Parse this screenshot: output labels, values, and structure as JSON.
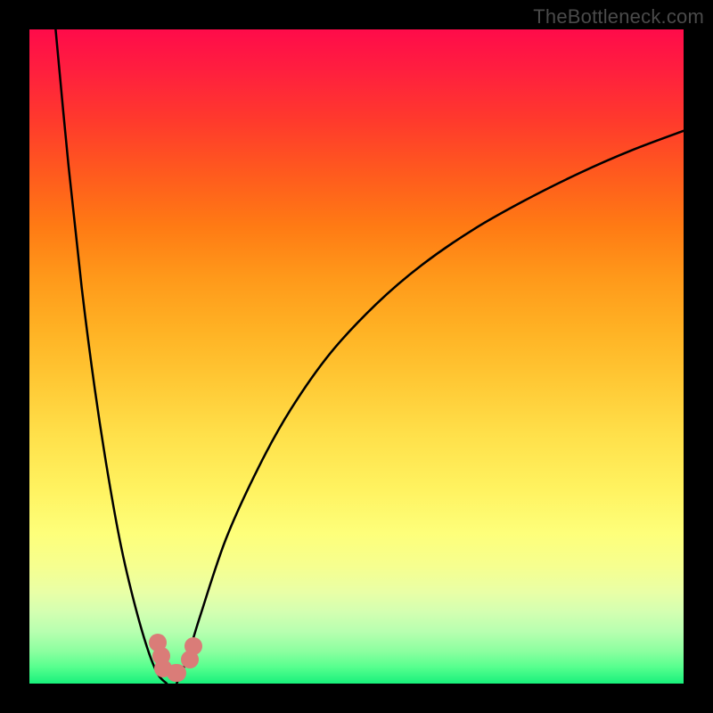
{
  "watermark": "TheBottleneck.com",
  "chart_data": {
    "type": "line",
    "title": "",
    "xlabel": "",
    "ylabel": "",
    "xlim": [
      0,
      100
    ],
    "ylim": [
      0,
      100
    ],
    "grid": false,
    "legend": false,
    "series": [
      {
        "name": "left-branch",
        "x": [
          4.0,
          6.0,
          8.0,
          10.0,
          12.0,
          14.0,
          16.0,
          18.0,
          19.6,
          21.0
        ],
        "values": [
          100.0,
          79.0,
          60.5,
          45.0,
          32.0,
          21.0,
          12.5,
          5.5,
          1.5,
          0.0
        ]
      },
      {
        "name": "right-branch",
        "x": [
          22.5,
          24.0,
          26.0,
          30.0,
          35.0,
          40.0,
          46.0,
          53.0,
          60.0,
          68.0,
          76.0,
          84.0,
          92.0,
          100.0
        ],
        "values": [
          0.0,
          3.5,
          10.0,
          22.0,
          33.0,
          42.0,
          50.5,
          58.0,
          64.0,
          69.5,
          74.0,
          78.0,
          81.5,
          84.5
        ]
      }
    ],
    "markers": [
      {
        "name": "cluster-point",
        "x": 19.6,
        "y": 6.2
      },
      {
        "name": "cluster-point",
        "x": 20.2,
        "y": 4.2
      },
      {
        "name": "cluster-point",
        "x": 20.5,
        "y": 2.3
      },
      {
        "name": "cluster-point",
        "x": 22.4,
        "y": 1.7
      },
      {
        "name": "cluster-point",
        "x": 22.6,
        "y": 1.7
      },
      {
        "name": "cluster-point",
        "x": 24.5,
        "y": 3.7
      },
      {
        "name": "cluster-point",
        "x": 25.0,
        "y": 5.7
      }
    ]
  }
}
